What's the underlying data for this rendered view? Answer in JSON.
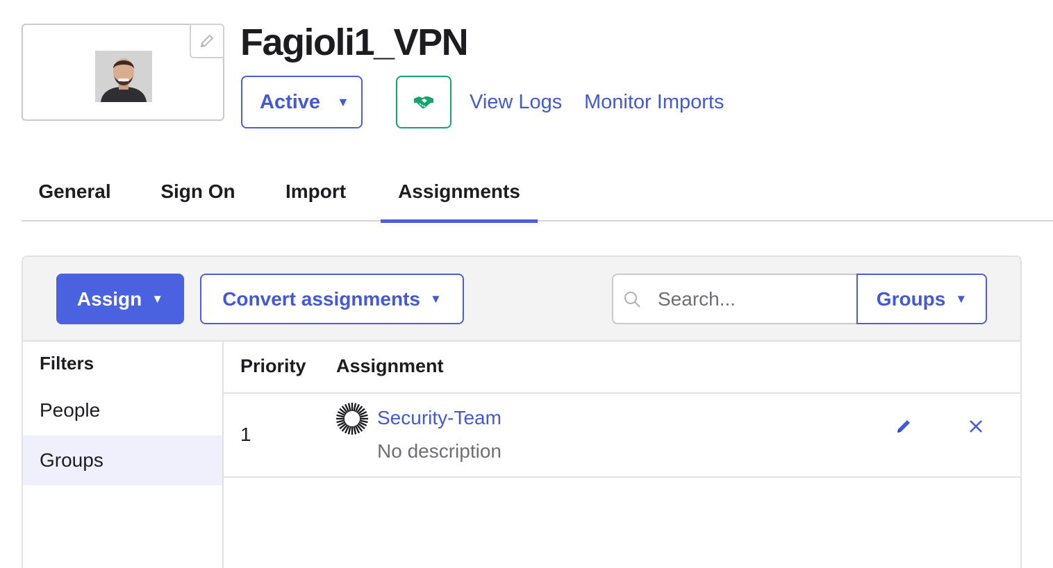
{
  "app": {
    "title": "Fagioli1_VPN",
    "status_label": "Active",
    "links": {
      "view_logs": "View Logs",
      "monitor_imports": "Monitor Imports"
    }
  },
  "tabs": [
    {
      "label": "General",
      "active": false
    },
    {
      "label": "Sign On",
      "active": false
    },
    {
      "label": "Import",
      "active": false
    },
    {
      "label": "Assignments",
      "active": true
    }
  ],
  "toolbar": {
    "assign_label": "Assign",
    "convert_label": "Convert assignments",
    "search_placeholder": "Search...",
    "type_filter": "Groups"
  },
  "filters": {
    "title": "Filters",
    "items": [
      {
        "label": "People",
        "selected": false
      },
      {
        "label": "Groups",
        "selected": true
      }
    ]
  },
  "table": {
    "columns": [
      "Priority",
      "Assignment"
    ],
    "rows": [
      {
        "priority": "1",
        "name": "Security-Team",
        "description": "No description"
      }
    ]
  },
  "colors": {
    "accent": "#4b5ee0",
    "link": "#4359d8",
    "success": "#16a36f",
    "panel_bg": "#f3f3f4",
    "selected_filter_bg": "#eff0fb"
  },
  "icons": {
    "logo_edit": "pencil-icon",
    "handshake": "handshake-icon",
    "search": "search-icon",
    "caret": "caret-down-icon",
    "group": "group-sunburst-icon",
    "row_edit": "pencil-icon",
    "row_remove": "close-icon"
  }
}
